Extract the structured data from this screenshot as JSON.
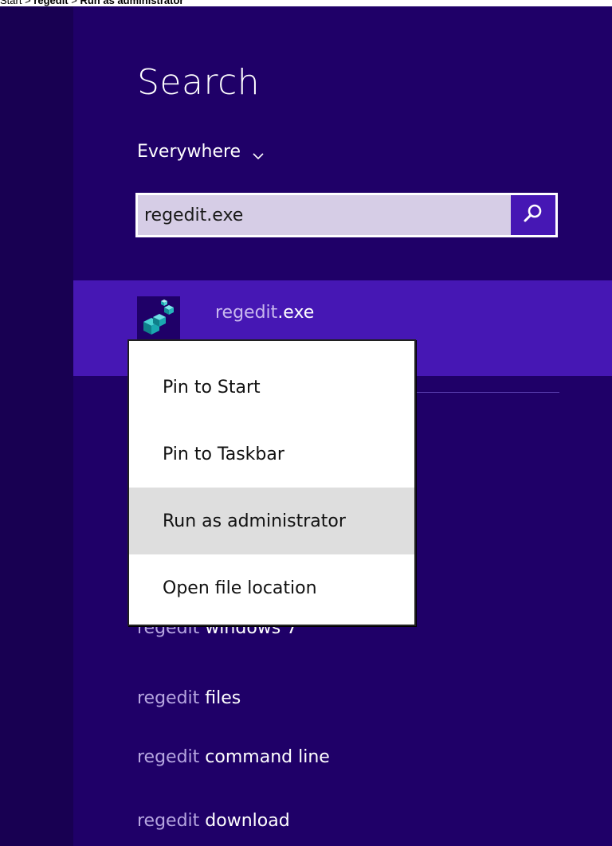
{
  "caption": {
    "parts": [
      "Start",
      " > ",
      "regedit",
      " > ",
      "Run as administrator"
    ]
  },
  "search": {
    "title": "Search",
    "scope_label": "Everywhere",
    "query": "regedit.exe"
  },
  "result": {
    "match": "regedit",
    "rest": ".exe"
  },
  "context_menu": {
    "items": [
      "Pin to Start",
      "Pin to Taskbar",
      "Run as administrator",
      "Open file location"
    ],
    "highlighted_index": 2
  },
  "suggestions": [
    {
      "match": "regedit",
      "rest": " windows 7"
    },
    {
      "match": "regedit",
      "rest": " files"
    },
    {
      "match": "regedit",
      "rest": " command line"
    },
    {
      "match": "regedit",
      "rest": " download"
    }
  ],
  "colors": {
    "background": "#1f0068",
    "accent": "#4617b4",
    "menu_hover": "#dedede"
  },
  "icons": {
    "search_button": "magnifier-icon",
    "scope_dropdown": "chevron-down-icon",
    "result": "registry-editor-icon"
  }
}
